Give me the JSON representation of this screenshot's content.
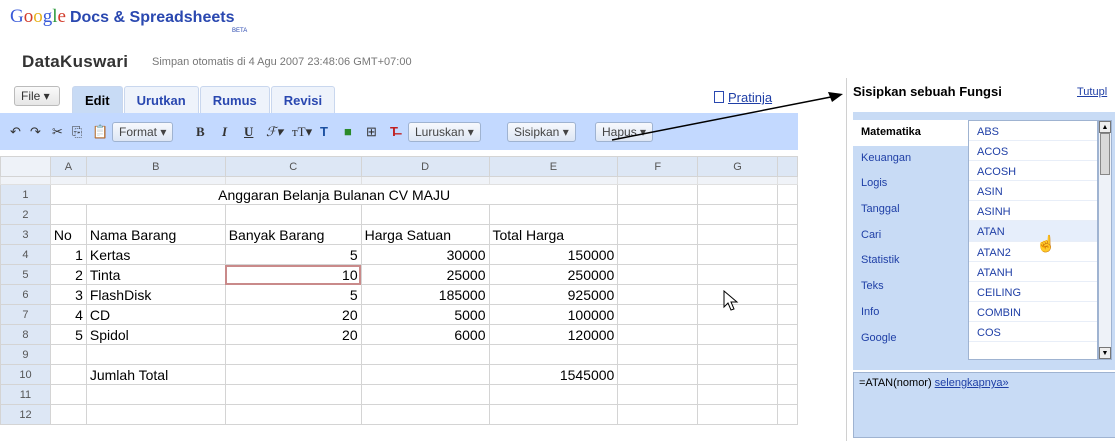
{
  "header": {
    "logo_google": "Google",
    "logo_product": "Docs & Spreadsheets",
    "beta": "BETA",
    "doc_title": "DataKuswari",
    "autosave": "Simpan otomatis di 4 Agu 2007 23:48:06 GMT+07:00"
  },
  "menu": {
    "file": "File ▾",
    "tabs": [
      "Edit",
      "Urutkan",
      "Rumus",
      "Revisi"
    ],
    "preview": "Pratinja"
  },
  "toolbar": {
    "format": "Format ▾",
    "luruskan": "Luruskan ▾",
    "sisipkan": "Sisipkan ▾",
    "hapus": "Hapus ▾",
    "icons": [
      "undo-icon",
      "redo-icon",
      "cut-icon",
      "copy-icon",
      "paste-icon",
      "bold-icon",
      "italic-icon",
      "underline-icon",
      "font-icon",
      "font-size-icon",
      "text-color-icon",
      "bg-color-icon",
      "borders-icon",
      "clear-format-icon"
    ]
  },
  "sheet": {
    "columns": [
      "A",
      "B",
      "C",
      "D",
      "E",
      "F",
      "G"
    ],
    "rows": [
      {
        "n": "1",
        "cells": [
          "",
          "",
          "",
          "",
          "",
          "",
          ""
        ],
        "merged_title": "Anggaran Belanja Bulanan CV MAJU"
      },
      {
        "n": "2",
        "cells": [
          "",
          "",
          "",
          "",
          "",
          "",
          ""
        ]
      },
      {
        "n": "3",
        "cells": [
          "No",
          "Nama Barang",
          "Banyak Barang",
          "Harga Satuan",
          "Total Harga",
          "",
          ""
        ]
      },
      {
        "n": "4",
        "cells": [
          "1",
          "Kertas",
          "5",
          "30000",
          "150000",
          "",
          ""
        ]
      },
      {
        "n": "5",
        "cells": [
          "2",
          "Tinta",
          "10",
          "25000",
          "250000",
          "",
          ""
        ]
      },
      {
        "n": "6",
        "cells": [
          "3",
          "FlashDisk",
          "5",
          "185000",
          "925000",
          "",
          ""
        ]
      },
      {
        "n": "7",
        "cells": [
          "4",
          "CD",
          "20",
          "5000",
          "100000",
          "",
          ""
        ]
      },
      {
        "n": "8",
        "cells": [
          "5",
          "Spidol",
          "20",
          "6000",
          "120000",
          "",
          ""
        ]
      },
      {
        "n": "9",
        "cells": [
          "",
          "",
          "",
          "",
          "",
          "",
          ""
        ]
      },
      {
        "n": "10",
        "cells": [
          "",
          "Jumlah Total",
          "",
          "",
          "1545000",
          "",
          ""
        ]
      },
      {
        "n": "11",
        "cells": [
          "",
          "",
          "",
          "",
          "",
          "",
          ""
        ]
      },
      {
        "n": "12",
        "cells": [
          "",
          "",
          "",
          "",
          "",
          "",
          ""
        ]
      }
    ]
  },
  "function_panel": {
    "title": "Sisipkan sebuah Fungsi",
    "close": "Tutupl",
    "categories": [
      "Matematika",
      "Keuangan",
      "Logis",
      "Tanggal",
      "Cari",
      "Statistik",
      "Teks",
      "Info",
      "Google"
    ],
    "active_category": "Matematika",
    "functions": [
      "ABS",
      "ACOS",
      "ACOSH",
      "ASIN",
      "ASINH",
      "ATAN",
      "ATAN2",
      "ATANH",
      "CEILING",
      "COMBIN",
      "COS"
    ],
    "highlighted_function": "ATAN",
    "syntax": "=ATAN(nomor)",
    "more_link": "selengkapnya»"
  }
}
